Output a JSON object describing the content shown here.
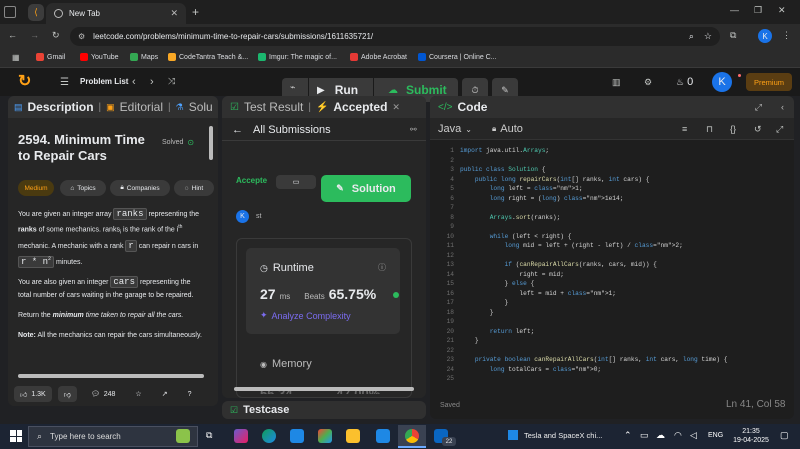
{
  "browser": {
    "tab_title": "New Tab",
    "url": "leetcode.com/problems/minimum-time-to-repair-cars/submissions/1611635721/",
    "profile_initial": "K",
    "bookmarks": [
      {
        "label": "Gmail",
        "color": "#ea4335"
      },
      {
        "label": "YouTube",
        "color": "#ff0000"
      },
      {
        "label": "Maps",
        "color": "#34a853"
      },
      {
        "label": "CodeTantra Teach &...",
        "color": "#f9a825"
      },
      {
        "label": "Imgur: The magic of...",
        "color": "#1bb76e"
      },
      {
        "label": "Adobe Acrobat",
        "color": "#e53935"
      },
      {
        "label": "Coursera | Online C...",
        "color": "#0056d2"
      }
    ]
  },
  "lcnav": {
    "problem_list": "Problem List",
    "run": "Run",
    "submit": "Submit",
    "streak": "0",
    "avatar": "K",
    "premium": "Premium"
  },
  "left": {
    "tabs": [
      "Description",
      "Editorial",
      "Solu"
    ],
    "title": "2594. Minimum Time to Repair Cars",
    "solved": "Solved",
    "tags": [
      "Medium",
      "Topics",
      "Companies",
      "Hint"
    ],
    "p1_a": "You are given an integer array",
    "p1_code": "ranks",
    "p1_b": "representing the",
    "p1_bold": "ranks",
    "p1_c": "of some mechanics. ranks",
    "p1_sub": "i",
    "p1_d": "is the rank of the i",
    "p1_sup": "th",
    "p1_e": "mechanic. A mechanic with a rank",
    "p1_code2": "r",
    "p1_f": "can repair n cars in",
    "p1_code3": "r * n",
    "p1_sup2": "2",
    "p1_g": "minutes.",
    "p2_a": "You are also given an integer",
    "p2_code": "cars",
    "p2_b": "representing the total number of cars waiting in the garage to be repaired.",
    "p3_a": "Return the",
    "p3_bold": "minimum",
    "p3_b": "time taken to repair all the cars.",
    "note_bold": "Note:",
    "note": "All the mechanics can repair the cars simultaneously.",
    "likes": "1.3K",
    "comments": "248"
  },
  "middle": {
    "tabs": [
      "Test Result",
      "Accepted"
    ],
    "all_submissions": "All Submissions",
    "accepted_short": "Accepte",
    "solution_btn": "Solution",
    "user_initial": "K",
    "user_short": "st",
    "runtime_label": "Runtime",
    "runtime_value": "27",
    "runtime_unit": "ms",
    "beats_label": "Beats",
    "beats_value": "65.75%",
    "analyze": "Analyze Complexity",
    "memory_label": "Memory",
    "memory_partial": "56.34",
    "memory_beats_partial": "47.00%",
    "testcase": "Testcase"
  },
  "code": {
    "title": "Code",
    "language": "Java",
    "mode": "Auto",
    "saved": "Saved",
    "cursor": "Ln 41, Col 58",
    "lines": [
      "import java.util.Arrays;",
      "",
      "public class Solution {",
      "    public long repairCars(int[] ranks, int cars) {",
      "        long left = 1;",
      "        long right = (long) 1e14;",
      "",
      "        Arrays.sort(ranks);",
      "",
      "        while (left < right) {",
      "            long mid = left + (right - left) / 2;",
      "",
      "            if (canRepairAllCars(ranks, cars, mid)) {",
      "                right = mid;",
      "            } else {",
      "                left = mid + 1;",
      "            }",
      "        }",
      "",
      "        return left;",
      "    }",
      "",
      "    private boolean canRepairAllCars(int[] ranks, int cars, long time) {",
      "        long totalCars = 0;",
      ""
    ]
  },
  "taskbar": {
    "search_placeholder": "Type here to search",
    "news": "Tesla and SpaceX chi...",
    "lang": "ENG",
    "time": "21:35",
    "date": "19-04-2025",
    "badge": "22"
  }
}
